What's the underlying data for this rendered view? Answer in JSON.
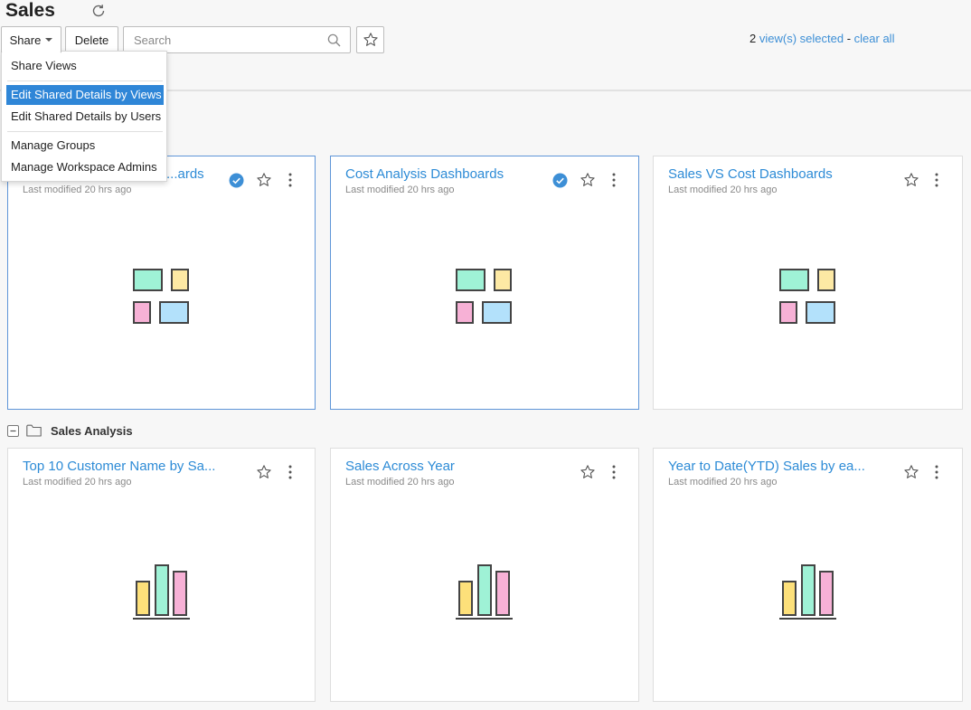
{
  "header": {
    "title": "Sales"
  },
  "toolbar": {
    "share_label": "Share",
    "delete_label": "Delete",
    "search_placeholder": "Search"
  },
  "selection": {
    "count": "2",
    "text": "view(s) selected",
    "sep": "-",
    "clear": "clear all"
  },
  "share_menu": {
    "items": [
      {
        "label": "Share Views"
      },
      {
        "label": "Edit Shared Details by Views"
      },
      {
        "label": "Edit Shared Details by Users"
      },
      {
        "label": "Manage Groups"
      },
      {
        "label": "Manage Workspace Admins"
      }
    ],
    "highlighted_item": "Edit Shared Details by Views"
  },
  "dashboards": [
    {
      "title": "...ards",
      "modified": "Last modified 20 hrs ago",
      "selected": true,
      "icon": "dashboard-icon"
    },
    {
      "title": "Cost Analysis Dashboards",
      "modified": "Last modified 20 hrs ago",
      "selected": true,
      "icon": "dashboard-icon"
    },
    {
      "title": "Sales VS Cost Dashboards",
      "modified": "Last modified 20 hrs ago",
      "selected": false,
      "icon": "dashboard-icon"
    }
  ],
  "folder": {
    "name": "Sales Analysis",
    "views": [
      {
        "title": "Top 10 Customer Name by Sa...",
        "modified": "Last modified 20 hrs ago",
        "icon": "bar-chart-icon"
      },
      {
        "title": "Sales Across Year",
        "modified": "Last modified 20 hrs ago",
        "icon": "bar-chart-icon"
      },
      {
        "title": "Year to Date(YTD) Sales by ea...",
        "modified": "Last modified 20 hrs ago",
        "icon": "bar-chart-icon"
      }
    ]
  },
  "colors": {
    "link": "#2d8bd6",
    "menu_highlight": "#2f86d7",
    "selected_border": "#5e95d8",
    "tile_green": "#9ff2d6",
    "tile_yellow": "#fde9a4",
    "tile_pink": "#f7b1d6",
    "tile_blue": "#b3e1fb"
  }
}
